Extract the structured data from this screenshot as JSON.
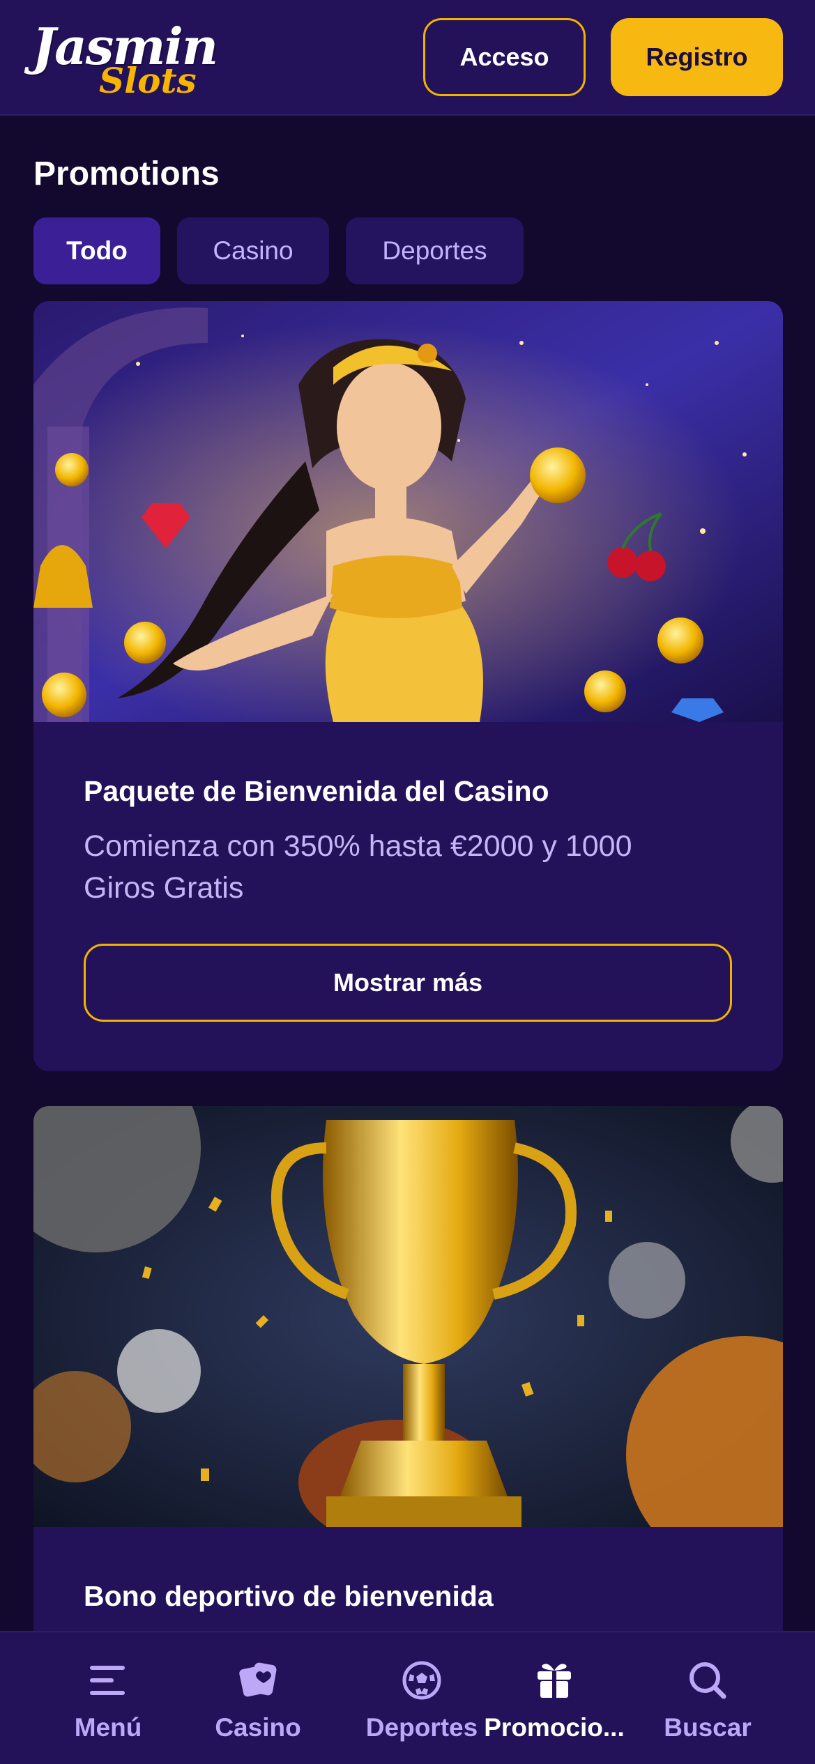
{
  "header": {
    "logo_main": "Jasmin",
    "logo_sub": "Slots",
    "login_label": "Acceso",
    "register_label": "Registro"
  },
  "page": {
    "title": "Promotions"
  },
  "tabs": [
    {
      "label": "Todo",
      "active": true
    },
    {
      "label": "Casino",
      "active": false
    },
    {
      "label": "Deportes",
      "active": false
    }
  ],
  "promotions": [
    {
      "title": "Paquete de Bienvenida del Casino",
      "description": "Comienza con 350% hasta €2000 y 1000 Giros Gratis",
      "button_label": "Mostrar más",
      "image": "genie-woman-with-gold-coins"
    },
    {
      "title": "Bono deportivo de bienvenida",
      "image": "golden-trophy-with-sports-balls"
    }
  ],
  "bottom_nav": [
    {
      "label": "Menú",
      "icon": "menu-icon",
      "active": false
    },
    {
      "label": "Casino",
      "icon": "casino-cards-icon",
      "active": false
    },
    {
      "label": "Deportes",
      "icon": "soccer-ball-icon",
      "active": false
    },
    {
      "label": "Promocio...",
      "icon": "gift-icon",
      "active": true
    },
    {
      "label": "Buscar",
      "icon": "search-icon",
      "active": false
    }
  ],
  "colors": {
    "background": "#13082e",
    "header": "#23115a",
    "accent": "#f7b911",
    "card": "#23125a",
    "muted_text": "#c6b4f5"
  }
}
